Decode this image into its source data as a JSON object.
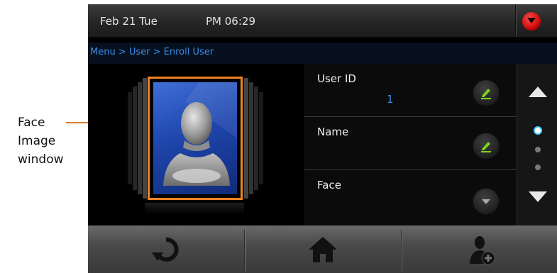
{
  "callout": {
    "lines": [
      "Face",
      "Image",
      "window"
    ]
  },
  "status_bar": {
    "date": "Feb 21 Tue",
    "time": "PM 06:29",
    "menu_icon": "red-down-arrow-icon"
  },
  "breadcrumb": {
    "text": "Menu > User > Enroll User"
  },
  "face_panel": {
    "icon": "user-silhouette-icon"
  },
  "fields": [
    {
      "label": "User ID",
      "value": "1",
      "button_icon": "edit-pencil-icon"
    },
    {
      "label": "Name",
      "value": "",
      "button_icon": "edit-pencil-icon"
    },
    {
      "label": "Face",
      "value": "",
      "button_icon": "dropdown-arrow-icon"
    }
  ],
  "scroll": {
    "page_indicator": {
      "current": 1,
      "total": 3
    }
  },
  "bottom_bar": {
    "buttons": [
      "refresh-icon",
      "home-icon",
      "add-user-icon"
    ]
  },
  "colors": {
    "accent": "#f08322",
    "link_blue": "#3b8de6",
    "edit_green": "#7ed321"
  }
}
